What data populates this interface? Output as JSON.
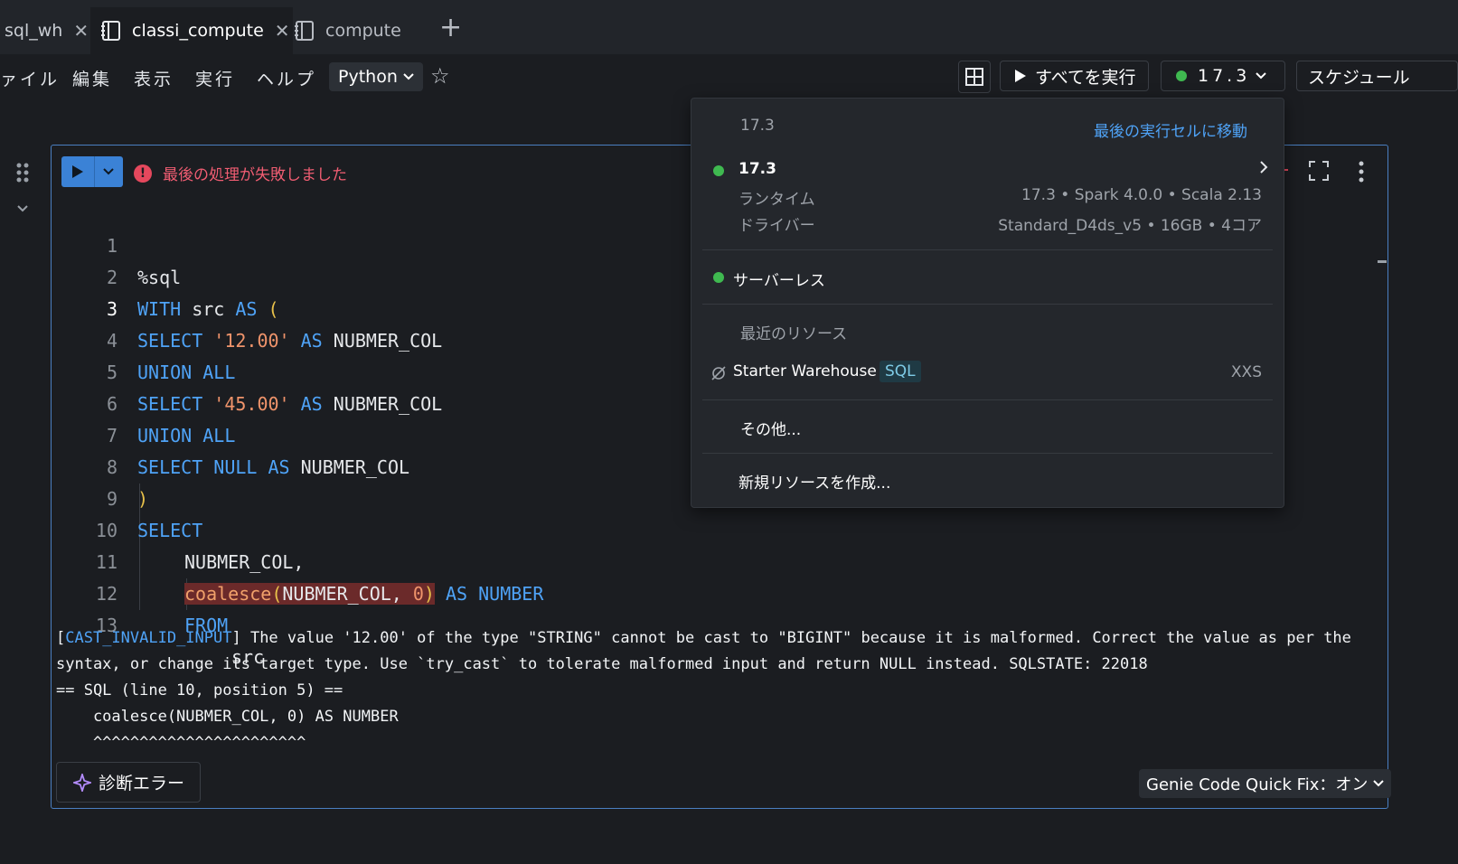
{
  "tabs": [
    {
      "label": "sql_wh",
      "close": "✕"
    },
    {
      "label": "classi_compute",
      "close": "✕"
    },
    {
      "label": "compute"
    }
  ],
  "add_tab": "+",
  "menu": {
    "file": "ァイル",
    "edit": "編集",
    "view": "表示",
    "run": "実行",
    "help": "ヘルプ",
    "language": "Python"
  },
  "toolbar": {
    "run_all": "すべてを実行",
    "compute_version": "17.3",
    "schedule": "スケジュール"
  },
  "cell": {
    "status": "最後の処理が失敗しました",
    "code_lines": [
      {
        "n": "1"
      },
      {
        "n": "2"
      },
      {
        "n": "3"
      },
      {
        "n": "4"
      },
      {
        "n": "5"
      },
      {
        "n": "6"
      },
      {
        "n": "7"
      },
      {
        "n": "8"
      },
      {
        "n": "9"
      },
      {
        "n": "10"
      },
      {
        "n": "11"
      },
      {
        "n": "12"
      },
      {
        "n": "13"
      }
    ],
    "code": {
      "l1": "%sql",
      "l2_kw1": "WITH",
      "l2_mid": " src ",
      "l2_kw2": "AS",
      "l2_par": " (",
      "l3_kw": "SELECT",
      "l3_str": "'12.00'",
      "l3_as": "AS",
      "l3_col": " NUBMER_COL",
      "l4": "UNION ALL",
      "l5_kw": "SELECT",
      "l5_str": "'45.00'",
      "l5_as": "AS",
      "l5_col": " NUBMER_COL",
      "l6": "UNION ALL",
      "l7_kw": "SELECT NULL AS",
      "l7_col": " NUBMER_COL",
      "l8": ")",
      "l9": "SELECT",
      "l10": "NUBMER_COL,",
      "l11_fn": "coalesce",
      "l11_p1": "(",
      "l11_arg": "NUBMER_COL, ",
      "l11_num": "0",
      "l11_p2": ")",
      "l11_as": "AS NUMBER",
      "l12": "FROM",
      "l13": "src"
    },
    "output": {
      "err_code": "CAST_INVALID_INPUT",
      "line1_rest": "] The value '12.00' of the type \"STRING\" cannot be cast to \"BIGINT\" because it is malformed. Correct the value as per the",
      "line2": "syntax, or change its target type. Use `try_cast` to tolerate malformed input and return NULL instead. SQLSTATE: 22018",
      "line3": "== SQL (line 10, position 5) ==",
      "line4": "    coalesce(NUBMER_COL, 0) AS NUMBER",
      "line5": "    ^^^^^^^^^^^^^^^^^^^^^^^"
    },
    "diagnose_button": "診断エラー",
    "genie_fix": "Genie Code Quick Fix：オン"
  },
  "dropdown": {
    "header_version": "17.3",
    "goto_link": "最後の実行セルに移動",
    "cluster_name": "17.3",
    "runtime_label": "ランタイム",
    "runtime_value": "17.3 • Spark 4.0.0 • Scala 2.13",
    "driver_label": "ドライバー",
    "driver_value": "Standard_D4ds_v5 • 16GB • 4コア",
    "serverless": "サーバーレス",
    "recent_label": "最近のリソース",
    "warehouse_name": "Starter Warehouse",
    "warehouse_badge": "SQL",
    "warehouse_size": "XXS",
    "more": "その他...",
    "create": "新規リソースを作成..."
  },
  "colors": {
    "accent": "#3b82d6",
    "error": "#e5485d",
    "keyword": "#4fa3f7",
    "string": "#f0946b",
    "running": "#3fb950"
  }
}
